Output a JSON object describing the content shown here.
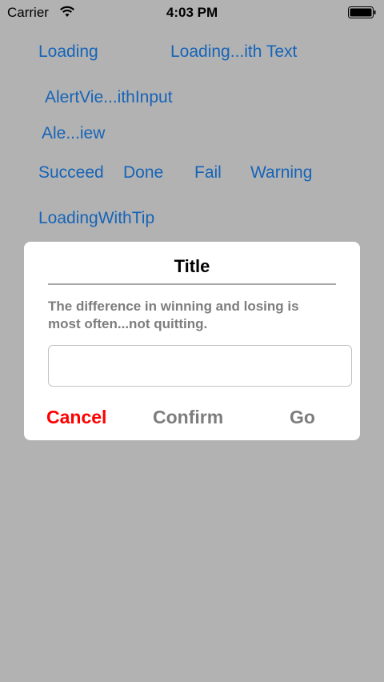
{
  "status_bar": {
    "carrier": "Carrier",
    "time": "4:03 PM",
    "wifi_icon": "wifi-icon",
    "battery_icon": "battery-full-icon"
  },
  "menu": {
    "loading": "Loading",
    "loading_with_text": "Loading...ith Text",
    "alert_with_input": "AlertVie...ithInput",
    "alert_view": "Ale...iew",
    "succeed": "Succeed",
    "done": "Done",
    "fail": "Fail",
    "warning": "Warning",
    "loading_with_tip": "LoadingWithTip"
  },
  "dialog": {
    "title": "Title",
    "message": "The difference in winning and losing is\n most often...not quitting.",
    "input_value": "",
    "input_placeholder": "",
    "cancel_label": "Cancel",
    "confirm_label": "Confirm",
    "go_label": "Go"
  },
  "colors": {
    "overlay": "#b2b2b2",
    "link": "#1664b8",
    "cancel": "#ff0000",
    "secondary": "#7d7d7d"
  }
}
